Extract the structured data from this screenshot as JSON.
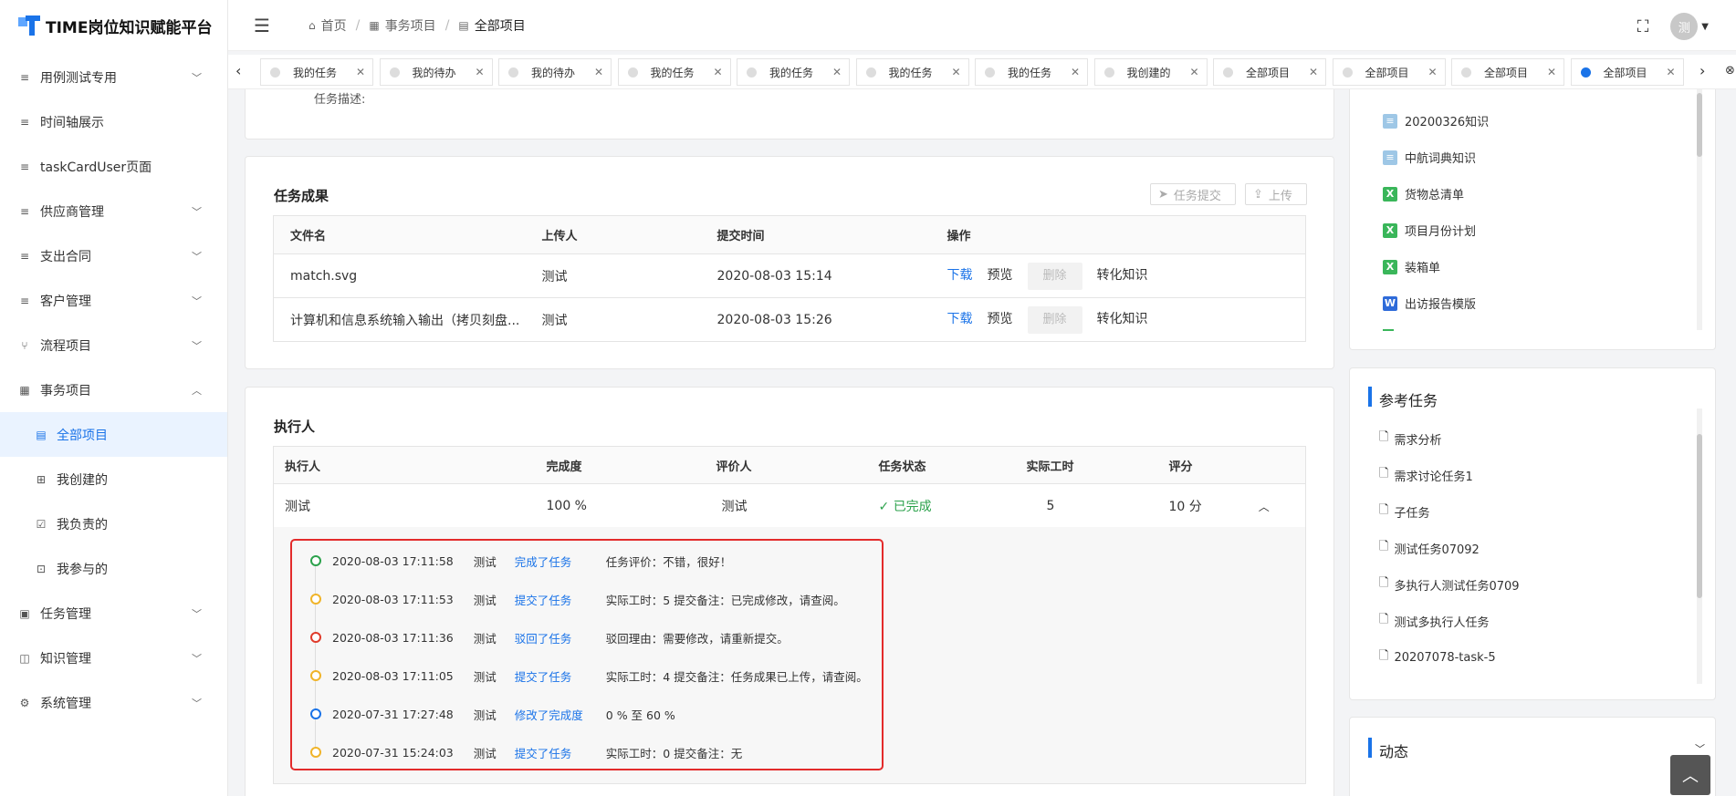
{
  "app": {
    "title": "TIME岗位知识赋能平台"
  },
  "sidebar": {
    "items": [
      {
        "label": "用例测试专用",
        "icon": "list-icon",
        "arrow": "chevron-down"
      },
      {
        "label": "时间轴展示",
        "icon": "list-icon",
        "arrow": ""
      },
      {
        "label": "taskCardUser页面",
        "icon": "list-icon",
        "arrow": ""
      },
      {
        "label": "供应商管理",
        "icon": "list-icon",
        "arrow": "chevron-down"
      },
      {
        "label": "支出合同",
        "icon": "list-icon",
        "arrow": "chevron-down"
      },
      {
        "label": "客户管理",
        "icon": "list-icon",
        "arrow": "chevron-down"
      },
      {
        "label": "流程项目",
        "icon": "branch-icon",
        "arrow": "chevron-down"
      },
      {
        "label": "事务项目",
        "icon": "grid-icon",
        "arrow": "chevron-up"
      },
      {
        "label": "全部项目",
        "icon": "doc-icon",
        "arrow": "",
        "sub": true,
        "active": true
      },
      {
        "label": "我创建的",
        "icon": "plus-box-icon",
        "arrow": "",
        "sub": true
      },
      {
        "label": "我负责的",
        "icon": "check-box-icon",
        "arrow": "",
        "sub": true
      },
      {
        "label": "我参与的",
        "icon": "play-box-icon",
        "arrow": "",
        "sub": true
      },
      {
        "label": "任务管理",
        "icon": "calendar-check-icon",
        "arrow": "chevron-down"
      },
      {
        "label": "知识管理",
        "icon": "book-icon",
        "arrow": "chevron-down"
      },
      {
        "label": "系统管理",
        "icon": "gear-icon",
        "arrow": "chevron-down"
      }
    ]
  },
  "header": {
    "breadcrumb": [
      "首页",
      "事务项目",
      "全部项目"
    ],
    "avatar": "测"
  },
  "tabs": [
    {
      "label": "我的任务"
    },
    {
      "label": "我的待办"
    },
    {
      "label": "我的待办"
    },
    {
      "label": "我的任务"
    },
    {
      "label": "我的任务"
    },
    {
      "label": "我的任务"
    },
    {
      "label": "我的任务"
    },
    {
      "label": "我创建的"
    },
    {
      "label": "全部项目"
    },
    {
      "label": "全部项目"
    },
    {
      "label": "全部项目"
    },
    {
      "label": "全部项目",
      "active": true
    }
  ],
  "desc": {
    "label": "任务描述:"
  },
  "results": {
    "title": "任务成果",
    "submit_label": "任务提交",
    "upload_label": "上传",
    "headers": [
      "文件名",
      "上传人",
      "提交时间",
      "操作"
    ],
    "rows": [
      {
        "file": "match.svg",
        "uploader": "测试",
        "time": "2020-08-03 15:14"
      },
      {
        "file": "计算机和信息系统输入输出（拷贝刻盘...",
        "uploader": "测试",
        "time": "2020-08-03 15:26"
      }
    ],
    "actions": {
      "download": "下载",
      "preview": "预览",
      "delete": "删除",
      "convert": "转化知识"
    }
  },
  "executors": {
    "title": "执行人",
    "headers": [
      "执行人",
      "完成度",
      "评价人",
      "任务状态",
      "实际工时",
      "评分"
    ],
    "row": {
      "name": "测试",
      "progress": "100 %",
      "reviewer": "测试",
      "status": "已完成",
      "hours": "5",
      "score": "10 分"
    }
  },
  "timeline": [
    {
      "time": "2020-08-03 17:11:58",
      "user": "测试",
      "action": "完成了任务",
      "detail": "任务评价：不错，很好！",
      "color": "#2ca24c"
    },
    {
      "time": "2020-08-03 17:11:53",
      "user": "测试",
      "action": "提交了任务",
      "detail": "实际工时：5   提交备注：已完成修改，请查阅。",
      "color": "#f0b429"
    },
    {
      "time": "2020-08-03 17:11:36",
      "user": "测试",
      "action": "驳回了任务",
      "detail": "驳回理由：需要修改，请重新提交。",
      "color": "#e03b2b"
    },
    {
      "time": "2020-08-03 17:11:05",
      "user": "测试",
      "action": "提交了任务",
      "detail": "实际工时：4   提交备注：任务成果已上传，请查阅。",
      "color": "#f0b429"
    },
    {
      "time": "2020-07-31 17:27:48",
      "user": "测试",
      "action": "修改了完成度",
      "detail": "0 %  至  60 %",
      "color": "#1a73e8"
    },
    {
      "time": "2020-07-31 15:24:03",
      "user": "测试",
      "action": "提交了任务",
      "detail": "实际工时：0   提交备注：无",
      "color": "#f0b429"
    }
  ],
  "knowledge_files": [
    {
      "name": "20200326知识",
      "type": "doc"
    },
    {
      "name": "中航词典知识",
      "type": "doc"
    },
    {
      "name": "货物总清单",
      "type": "xls"
    },
    {
      "name": "项目月份计划",
      "type": "xls"
    },
    {
      "name": "装箱单",
      "type": "xls"
    },
    {
      "name": "出访报告模版",
      "type": "word"
    }
  ],
  "ref_tasks": {
    "title": "参考任务",
    "items": [
      "需求分析",
      "需求讨论任务1",
      "子任务",
      "测试任务07092",
      "多执行人测试任务0709",
      "测试多执行人任务",
      "20207078-task-5"
    ]
  },
  "activity": {
    "title": "动态"
  }
}
